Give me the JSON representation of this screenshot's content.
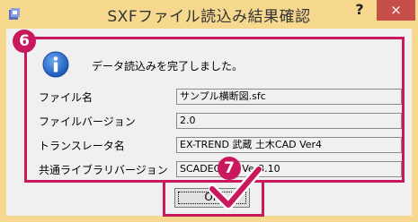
{
  "window": {
    "title": "SXFファイル読込み結果確認",
    "help_label": "?",
    "close_label": "×"
  },
  "message": "データ読込みを完了しました。",
  "fields": [
    {
      "label": "ファイル名",
      "value": "サンプル横断図.sfc"
    },
    {
      "label": "ファイルバージョン",
      "value": "2.0"
    },
    {
      "label": "トランスレータ名",
      "value": "EX-TREND 武蔵 土木CAD Ver4"
    },
    {
      "label": "共通ライブラリバージョン",
      "value": "SCADEC LIB Ver3.10"
    }
  ],
  "ok_label": "OK",
  "annotations": {
    "badge_a": "6",
    "badge_b": "7"
  },
  "colors": {
    "frame": "#f6d98e",
    "accent": "#c9185d",
    "close": "#c74f49"
  },
  "icons": {
    "app": "app-icon",
    "info": "info-icon",
    "check": "checkmark-icon"
  }
}
